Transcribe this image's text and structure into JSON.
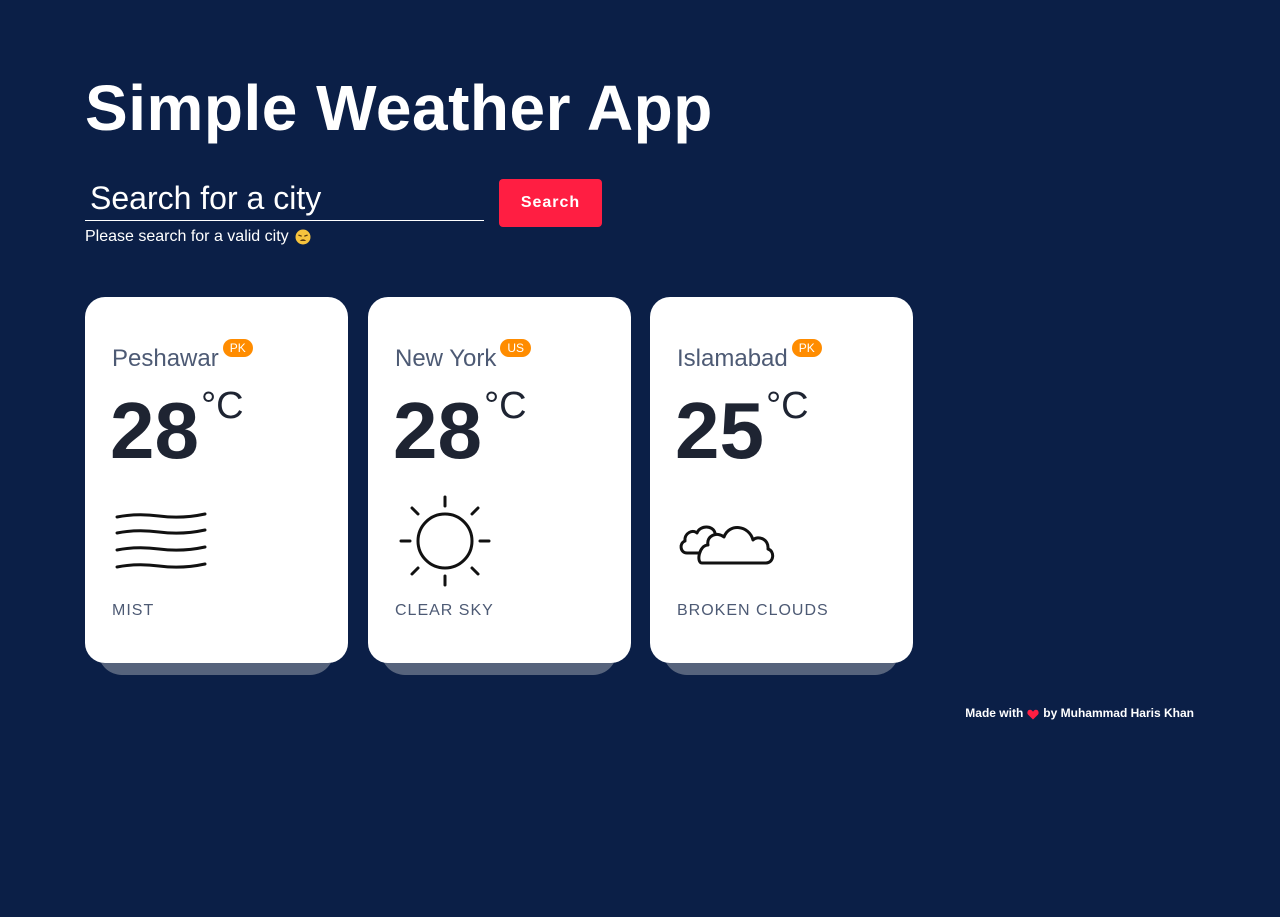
{
  "app": {
    "title": "Simple Weather App"
  },
  "search": {
    "placeholder": "Search for a city",
    "button_label": "Search",
    "message": "Please search for a valid city",
    "message_emoji": "weary-face-icon"
  },
  "cities": [
    {
      "name": "Peshawar",
      "country": "PK",
      "temp": "28",
      "unit": "°C",
      "icon": "mist-icon",
      "condition": "MIST"
    },
    {
      "name": "New York",
      "country": "US",
      "temp": "28",
      "unit": "°C",
      "icon": "sun-icon",
      "condition": "CLEAR SKY"
    },
    {
      "name": "Islamabad",
      "country": "PK",
      "temp": "25",
      "unit": "°C",
      "icon": "broken-clouds-icon",
      "condition": "BROKEN CLOUDS"
    }
  ],
  "footer": {
    "made_with": "Made with",
    "heart_icon": "heart-icon",
    "by_text": "by Muhammad Haris Khan"
  },
  "colors": {
    "background": "#0b1f47",
    "accent": "#ff1e42",
    "badge": "#ff8c00",
    "card": "#ffffff",
    "card_shadow": "#56637c",
    "muted_text": "#4d5a74",
    "temp_text": "#1e2432"
  }
}
